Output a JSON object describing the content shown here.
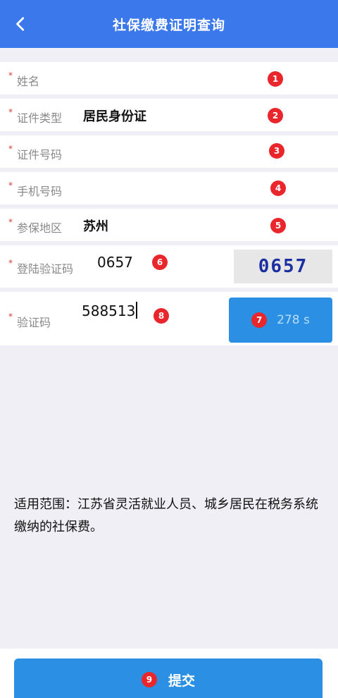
{
  "header": {
    "title": "社保缴费证明查询"
  },
  "fields": {
    "name": {
      "label": "姓名",
      "value": "",
      "badge": "1"
    },
    "id_type": {
      "label": "证件类型",
      "value": "居民身份证",
      "badge": "2"
    },
    "id_number": {
      "label": "证件号码",
      "value": "",
      "badge": "3"
    },
    "phone": {
      "label": "手机号码",
      "value": "",
      "badge": "4"
    },
    "region": {
      "label": "参保地区",
      "value": "苏州",
      "badge": "5"
    },
    "login_code": {
      "label": "登陆验证码",
      "value": "0657",
      "badge": "6",
      "captcha": "0657"
    },
    "verify_code": {
      "label": "验证码",
      "value": "588513",
      "badge": "8"
    }
  },
  "sms_button": {
    "label": "278 s",
    "badge": "7"
  },
  "notice": {
    "text": "适用范围：江苏省灵活就业人员、城乡居民在税务系统缴纳的社保费。"
  },
  "submit": {
    "label": "提交",
    "badge": "9"
  },
  "colors": {
    "primary": "#3a78ec",
    "button": "#2b8fe3",
    "badge": "#e8262b",
    "required": "#d93a3a"
  }
}
